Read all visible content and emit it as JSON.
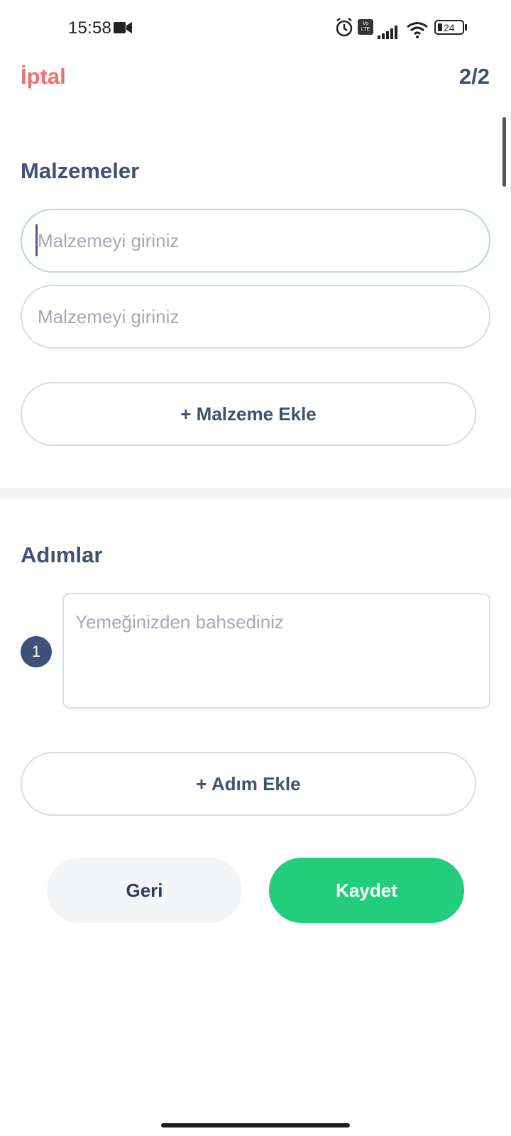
{
  "status_bar": {
    "time": "15:58",
    "battery": "24",
    "volte": "Vo\nLTE",
    "icons": [
      "video-camera-icon",
      "alarm-icon",
      "volte-icon",
      "signal-icon",
      "wifi-icon",
      "battery-icon"
    ]
  },
  "header": {
    "cancel_label": "İptal",
    "page_indicator": "2/2"
  },
  "ingredients": {
    "title": "Malzemeler",
    "inputs": [
      {
        "value": "",
        "placeholder": "Malzemeyi giriniz"
      },
      {
        "value": "",
        "placeholder": "Malzemeyi giriniz"
      }
    ],
    "add_label": "+ Malzeme Ekle"
  },
  "steps": {
    "title": "Adımlar",
    "items": [
      {
        "number": "1",
        "value": "",
        "placeholder": "Yemeğinizden bahsediniz"
      }
    ],
    "add_label": "+ Adım Ekle"
  },
  "actions": {
    "back_label": "Geri",
    "save_label": "Kaydet"
  },
  "colors": {
    "accent_cancel": "#f0706e",
    "text_primary": "#3f5174",
    "save_green": "#22cd7b",
    "badge": "#3e5178"
  }
}
